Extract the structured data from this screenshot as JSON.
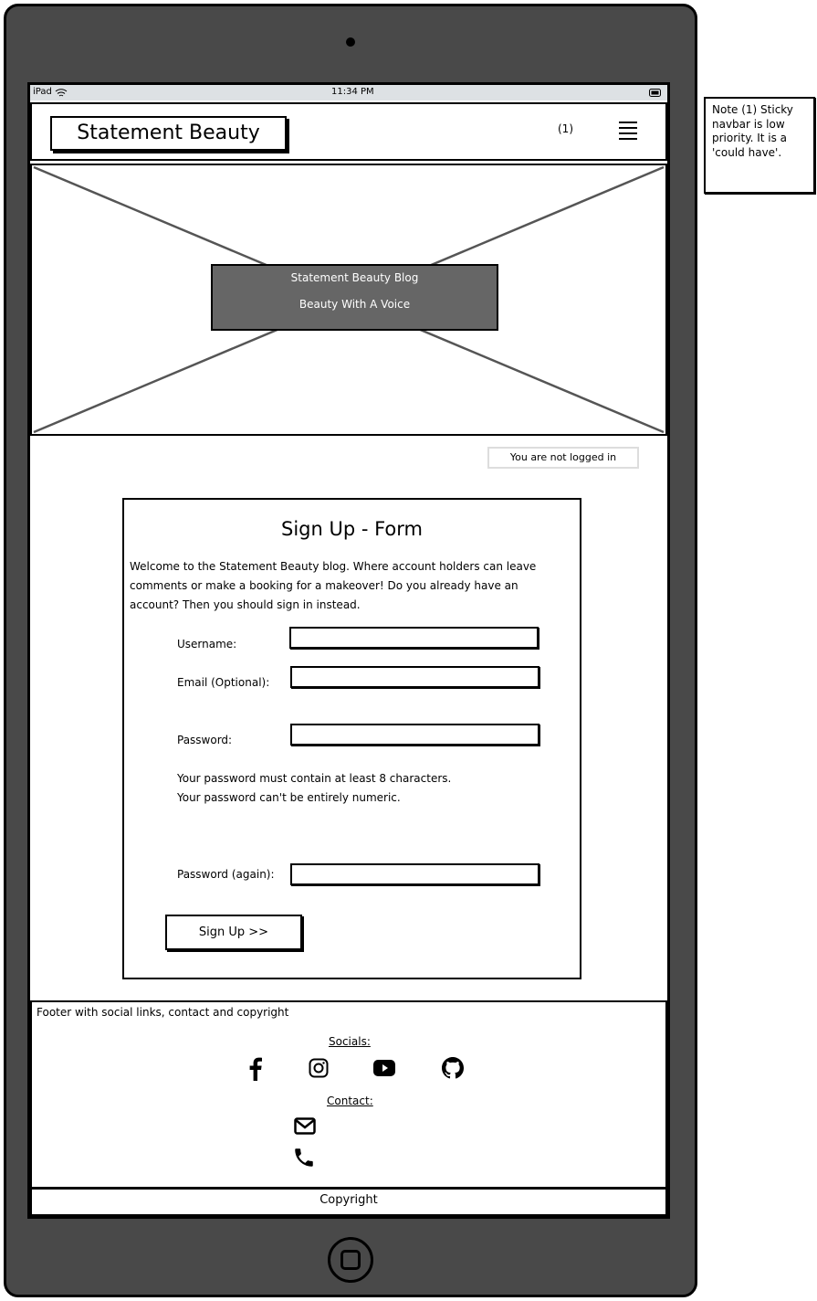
{
  "status_bar": {
    "device": "iPad",
    "time": "11:34 PM"
  },
  "navbar": {
    "brand": "Statement Beauty",
    "note_ref": "(1)",
    "menu_icon": "hamburger-icon"
  },
  "hero": {
    "title": "Statement Beauty Blog",
    "subtitle": "Beauty With A Voice"
  },
  "login_status": "You are not logged in",
  "form": {
    "title": "Sign Up - Form",
    "intro": "Welcome to the Statement Beauty blog. Where account holders can leave comments or make a booking for a makeover! Do you already have an account? Then you should sign in instead.",
    "fields": [
      {
        "label": "Username:",
        "value": ""
      },
      {
        "label": "Email (Optional):",
        "value": ""
      },
      {
        "label": "Password:",
        "value": ""
      },
      {
        "label": "Password (again):",
        "value": ""
      }
    ],
    "help": [
      "Your password must contain at least 8 characters.",
      "Your password can't be entirely numeric."
    ],
    "submit": "Sign Up >>"
  },
  "footer": {
    "description": "Footer with social links, contact and copyright",
    "socials_heading": "Socials:",
    "socials": [
      "facebook-icon",
      "instagram-icon",
      "youtube-icon",
      "github-icon"
    ],
    "contact_heading": "Contact:",
    "contact": [
      "envelope-icon",
      "phone-icon"
    ],
    "copyright": "Copyright"
  },
  "note": "Note (1) Sticky navbar is low priority. It is a 'could have'.",
  "colors": {
    "device": "#494949",
    "status_bar": "#dde1e4",
    "hero_overlay": "#666666"
  }
}
